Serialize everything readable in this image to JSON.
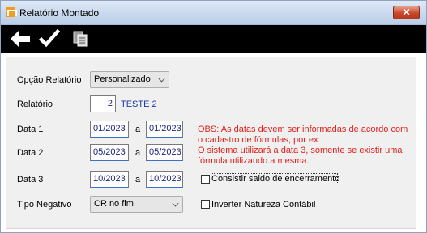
{
  "window": {
    "title": "Relatório Montado",
    "close_label": "✕"
  },
  "toolbar": {
    "items": [
      "back-arrow-icon",
      "checkmark-icon",
      "copy-pages-icon"
    ]
  },
  "form": {
    "opcao_relatorio": {
      "label": "Opção Relatório",
      "value": "Personalizado"
    },
    "relatorio": {
      "label": "Relatório",
      "number": "2",
      "name": "TESTE 2"
    },
    "data1": {
      "label": "Data 1",
      "from": "01/2023",
      "sep": "a",
      "to": "01/2023"
    },
    "data2": {
      "label": "Data 2",
      "from": "05/2023",
      "sep": "a",
      "to": "05/2023"
    },
    "data3": {
      "label": "Data 3",
      "from": "10/2023",
      "sep": "a",
      "to": "10/2023"
    },
    "tipo_negativo": {
      "label": "Tipo Negativo",
      "value": "CR no fim"
    },
    "obs": {
      "line1": "OBS: As datas devem ser informadas de acordo com",
      "line2": "o cadastro de fórmulas, por ex:",
      "line3": "O sistema utilizará a data 3, somente se existir uma",
      "line4": "fórmula utilizando a mesma."
    },
    "consistir": {
      "label": "Consistir saldo de encerramento",
      "checked": false
    },
    "inverter": {
      "label": "Inverter Natureza Contábil",
      "checked": false
    }
  },
  "colors": {
    "obs_text": "#e0201a",
    "field_text": "#1a237e",
    "toolbar_bg": "#000000"
  }
}
